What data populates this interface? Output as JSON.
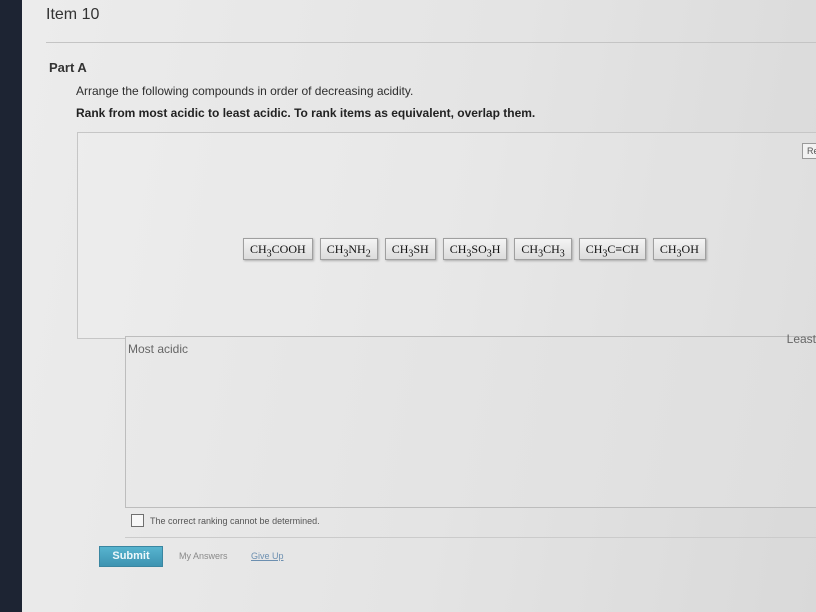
{
  "item": {
    "title": "Item 10"
  },
  "part": {
    "label": "Part A"
  },
  "question": {
    "instruction": "Arrange the following compounds in order of decreasing acidity.",
    "rank_note": "Rank from most acidic to least acidic. To rank items as equivalent, overlap them."
  },
  "reset_button": {
    "label": "Re"
  },
  "compounds": [
    {
      "html": "CH<sub>3</sub>COOH"
    },
    {
      "html": "CH<sub>3</sub>NH<sub>2</sub>"
    },
    {
      "html": "CH<sub>3</sub>SH"
    },
    {
      "html": "CH<sub>3</sub>SO<sub>3</sub>H"
    },
    {
      "html": "CH<sub>3</sub>CH<sub>3</sub>"
    },
    {
      "html": "CH<sub>3</sub>C&#8801;CH"
    },
    {
      "html": "CH<sub>3</sub>OH"
    }
  ],
  "ranking": {
    "most_label": "Most acidic",
    "least_label": "Least"
  },
  "checkbox": {
    "label": "The correct ranking cannot be determined.",
    "checked": false
  },
  "footer": {
    "submit_label": "Submit",
    "my_answers_label": "My Answers",
    "give_up_label": "Give Up"
  },
  "colors": {
    "submit_bg": "#4aa3c1",
    "link": "#6c8fb0"
  }
}
